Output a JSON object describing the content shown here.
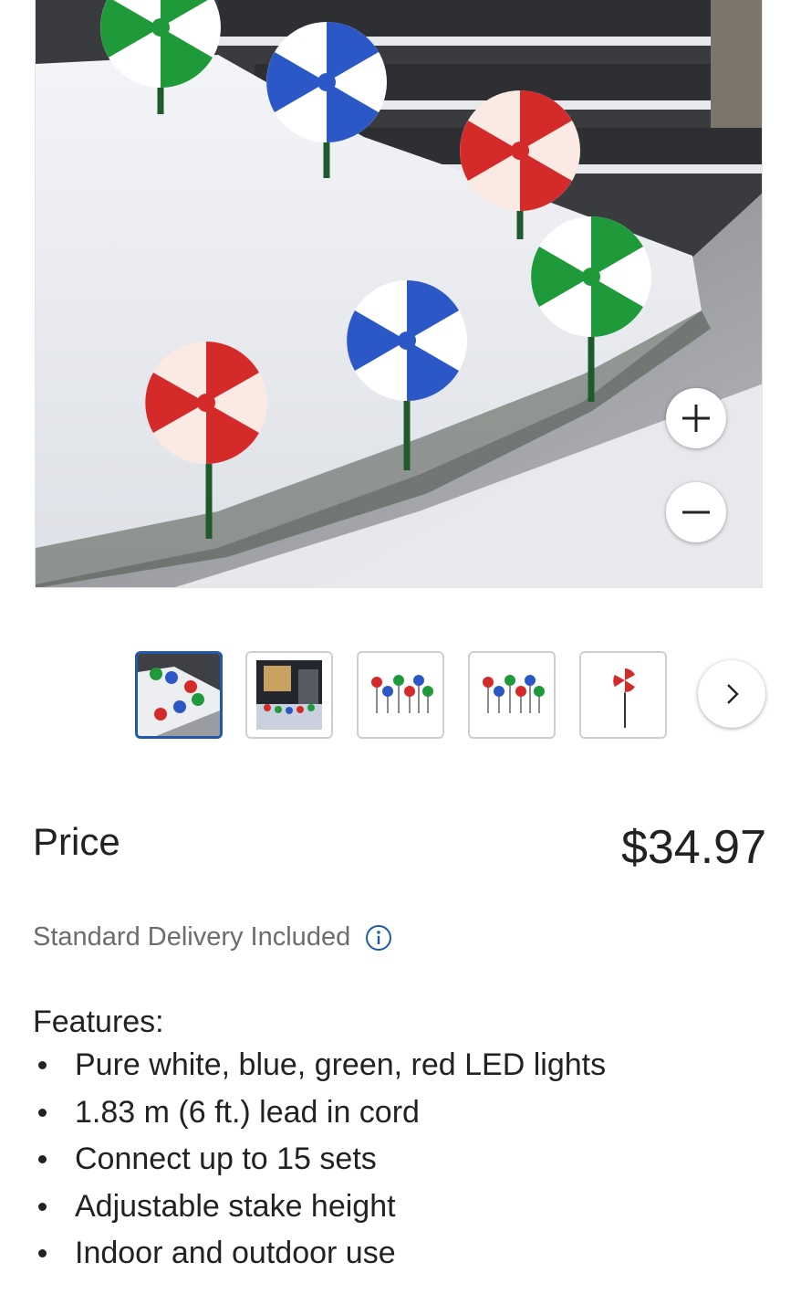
{
  "product": {
    "main_image_alt": "Pinwheel pathway lights in snowy yard",
    "thumbnails": [
      {
        "name": "lifestyle-snow",
        "active": true
      },
      {
        "name": "lifestyle-house-night",
        "active": false
      },
      {
        "name": "product-set-a",
        "active": false
      },
      {
        "name": "product-set-b",
        "active": false
      },
      {
        "name": "single-stake",
        "active": false
      }
    ],
    "zoom_in_icon": "plus-icon",
    "zoom_out_icon": "minus-icon",
    "next_icon": "chevron-right-icon"
  },
  "pricing": {
    "label": "Price",
    "value": "$34.97"
  },
  "delivery": {
    "text": "Standard Delivery Included",
    "icon": "info-icon"
  },
  "features": {
    "title": "Features:",
    "items": [
      "Pure white, blue, green, red LED lights",
      "1.83 m (6 ft.) lead in cord",
      "Connect up to 15 sets",
      "Adjustable stake height",
      "Indoor and outdoor use"
    ]
  },
  "colors": {
    "accent_border": "#1f5aa6",
    "pinwheel_red": "#d42a2a",
    "pinwheel_blue": "#2b58c6",
    "pinwheel_green": "#1e9a3a"
  }
}
